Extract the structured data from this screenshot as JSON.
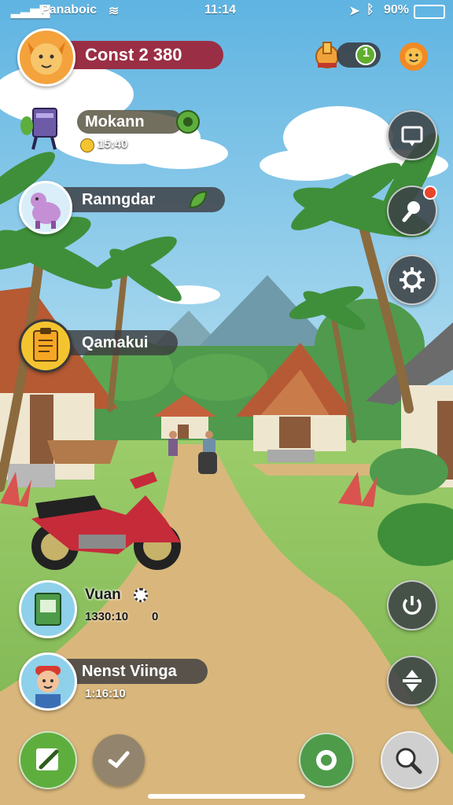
{
  "status_bar": {
    "carrier": "Panaboic",
    "time": "11:14",
    "battery": "90%"
  },
  "player": {
    "name": "Const 2 380"
  },
  "top_right": {
    "coin_value": "1",
    "coin_color": "#5fae2e"
  },
  "quests": [
    {
      "title": "Mokann",
      "sub": "15:40"
    },
    {
      "title": "Ranngdar"
    },
    {
      "title": "Qamakui"
    }
  ],
  "npcs": [
    {
      "name": "Vuan",
      "line1": "1330:10",
      "line2": "0"
    },
    {
      "name": "Nenst Viinga",
      "line1": "1:16:10"
    }
  ],
  "side_buttons": [
    "map-icon",
    "alert-icon",
    "settings-icon",
    "power-icon",
    "swap-icon"
  ],
  "bottom_buttons": [
    "edit-icon",
    "check-icon",
    "camera-icon",
    "chat-icon"
  ],
  "colors": {
    "sky": "#7fc6ea",
    "grass": "#8cc461",
    "road": "#d9b77c",
    "accent_red": "#9a2e44",
    "button_green": "#5eae3e"
  }
}
